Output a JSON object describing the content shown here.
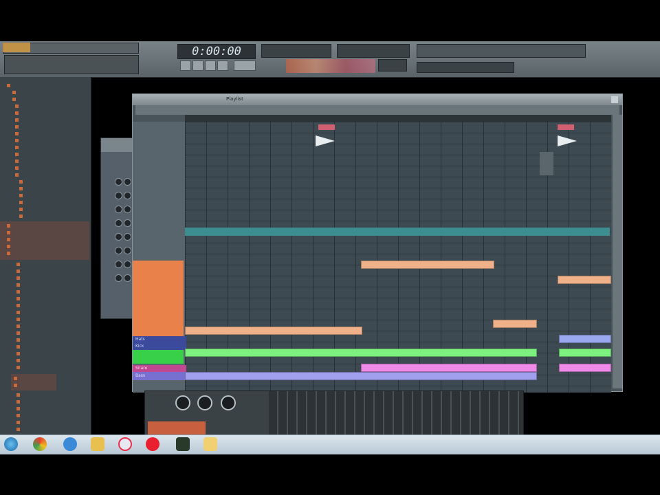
{
  "toolbar": {
    "time": "0:00:00",
    "song_label": "",
    "colors": {
      "accent": "#e8824a"
    }
  },
  "browser": {
    "items": [
      "",
      "",
      "",
      "",
      "",
      "",
      "",
      "",
      "",
      "",
      "",
      "",
      "",
      "",
      "",
      "",
      "",
      "",
      "",
      "",
      "",
      "",
      "",
      "",
      "",
      "",
      "",
      "",
      "",
      "",
      "",
      "",
      "",
      "",
      "",
      "",
      "",
      "",
      "",
      "",
      "",
      "",
      "",
      "",
      "",
      "",
      "",
      "",
      "",
      "",
      "",
      "",
      "",
      "",
      "",
      ""
    ]
  },
  "playlist": {
    "title": "Playlist",
    "pattern_names": [
      "",
      "",
      "",
      "",
      "",
      "",
      "",
      ""
    ],
    "track_labels": [
      "Hats",
      "Kick",
      "",
      "Snare",
      "Bass"
    ]
  },
  "taskbar": {
    "icons": [
      "windows-start-icon",
      "chrome-icon",
      "ie-icon",
      "folder-icon",
      "skype-icon",
      "opera-icon",
      "fl-studio-icon",
      "explorer-icon"
    ]
  }
}
